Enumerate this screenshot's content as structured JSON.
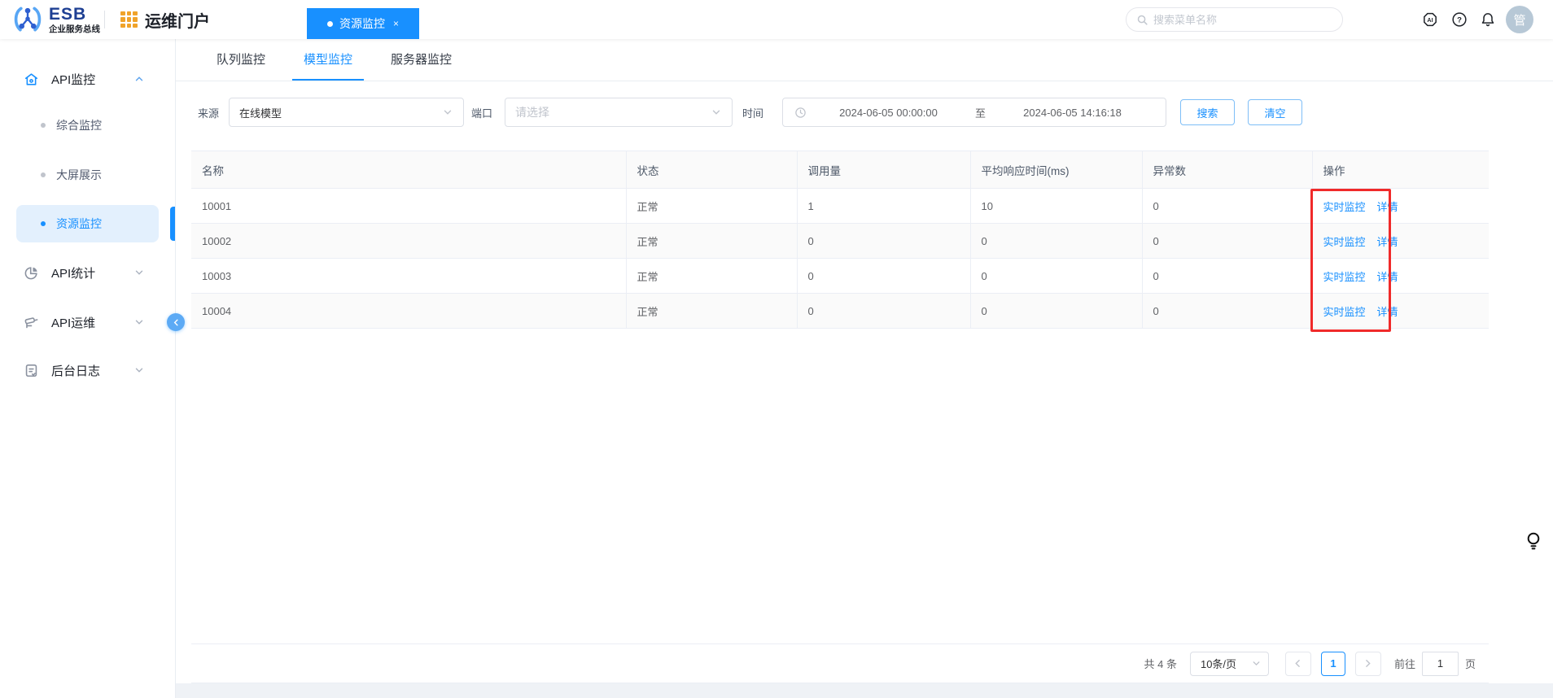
{
  "header": {
    "logo": {
      "title": "ESB",
      "subtitle": "企业服务总线"
    },
    "portal_title": "运维门户",
    "tab": {
      "label": "资源监控",
      "close": "×"
    },
    "search_placeholder": "搜索菜单名称",
    "ai_icon_label": "AI",
    "help_icon_label": "?",
    "avatar_text": "管"
  },
  "sidebar": {
    "items": [
      {
        "label": "API监控"
      },
      {
        "label": "综合监控"
      },
      {
        "label": "大屏展示"
      },
      {
        "label": "资源监控"
      },
      {
        "label": "API统计"
      },
      {
        "label": "API运维"
      },
      {
        "label": "后台日志"
      }
    ]
  },
  "tabs": [
    {
      "label": "队列监控"
    },
    {
      "label": "模型监控"
    },
    {
      "label": "服务器监控"
    }
  ],
  "filters": {
    "source_label": "来源",
    "source_value": "在线模型",
    "port_label": "端口",
    "port_placeholder": "请选择",
    "time_label": "时间",
    "time_start": "2024-06-05 00:00:00",
    "time_separator": "至",
    "time_end": "2024-06-05 14:16:18",
    "search_button": "搜索",
    "clear_button": "清空"
  },
  "table": {
    "columns": [
      "名称",
      "状态",
      "调用量",
      "平均响应时间(ms)",
      "异常数",
      "操作"
    ],
    "rows": [
      {
        "name": "10001",
        "status": "正常",
        "calls": "1",
        "avg_ms": "10",
        "errors": "0"
      },
      {
        "name": "10002",
        "status": "正常",
        "calls": "0",
        "avg_ms": "0",
        "errors": "0"
      },
      {
        "name": "10003",
        "status": "正常",
        "calls": "0",
        "avg_ms": "0",
        "errors": "0"
      },
      {
        "name": "10004",
        "status": "正常",
        "calls": "0",
        "avg_ms": "0",
        "errors": "0"
      }
    ],
    "actions": [
      "实时监控",
      "详情"
    ]
  },
  "pagination": {
    "total_text": "共 4 条",
    "page_size": "10条/页",
    "current_page": "1",
    "goto_label": "前往",
    "goto_value": "1",
    "page_label": "页"
  },
  "annotation": {
    "color": "#f02a2a"
  },
  "colors": {
    "primary": "#1890ff",
    "sidebar_active_bg": "#e3f0fd",
    "header_tab_bg": "#1890ff"
  }
}
